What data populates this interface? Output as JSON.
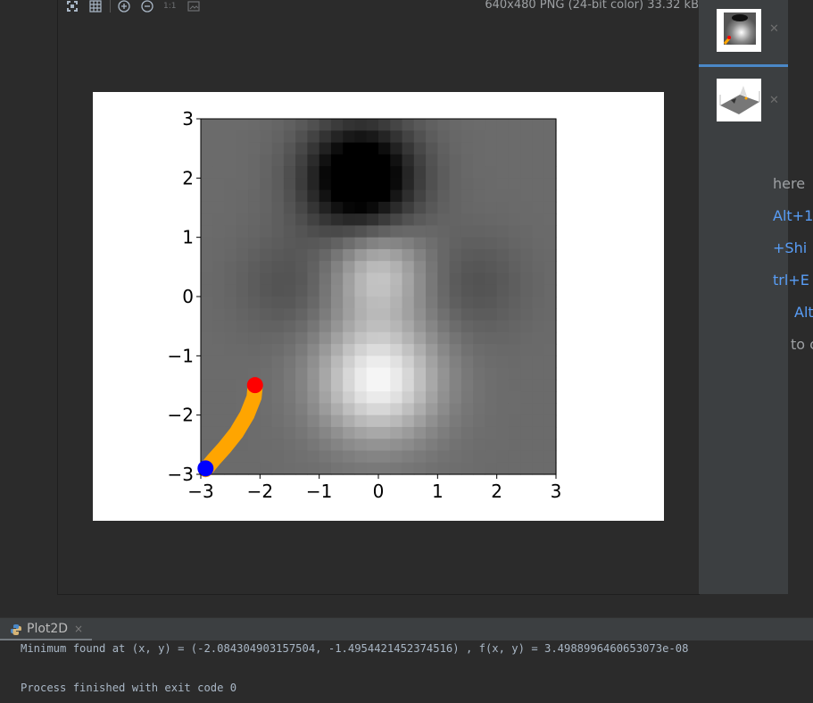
{
  "viewer": {
    "toolbar": {
      "icons": [
        "fit-window-icon",
        "grid-icon",
        "zoom-in-icon",
        "zoom-out-icon",
        "actual-size-icon",
        "background-icon"
      ],
      "actual_size_label": "1:1"
    },
    "image_info": "640x480 PNG (24-bit color) 33.32 kB"
  },
  "chart_data": {
    "type": "heatmap",
    "title": "",
    "xlabel": "",
    "ylabel": "",
    "xlim": [
      -3,
      3
    ],
    "ylim": [
      -3,
      3
    ],
    "xticks": [
      "−3",
      "−2",
      "−1",
      "0",
      "1",
      "2",
      "3"
    ],
    "yticks": [
      "−3",
      "−2",
      "−1",
      "0",
      "1",
      "2",
      "3"
    ],
    "colormap": "gray",
    "grid": false,
    "heatmap_features": {
      "darkest_at": [
        -0.4,
        2.0
      ],
      "brightest_at": [
        0.0,
        -1.4
      ]
    },
    "series": [
      {
        "type": "line",
        "color": "#ffa500",
        "x": [
          -2.92,
          -2.78,
          -2.6,
          -2.4,
          -2.22,
          -2.1,
          -2.08
        ],
        "y": [
          -2.92,
          -2.75,
          -2.55,
          -2.3,
          -2.0,
          -1.7,
          -1.5
        ]
      }
    ],
    "markers": [
      {
        "color": "#ff0000",
        "x": -2.084,
        "y": -1.495
      },
      {
        "color": "#0000ff",
        "x": -2.92,
        "y": -2.9
      }
    ]
  },
  "thumbnails": [
    {
      "name": "heatmap-plot",
      "selected": true
    },
    {
      "name": "surface-plot",
      "selected": false
    }
  ],
  "tips": [
    {
      "text": "here",
      "color": "#9da0a3"
    },
    {
      "text": "Alt+1",
      "color": "#589df6"
    },
    {
      "text": "+Shi",
      "color": "#589df6"
    },
    {
      "text": "trl+E",
      "color": "#589df6"
    },
    {
      "text": "Alt",
      "color": "#589df6"
    },
    {
      "text": "to c",
      "color": "#9da0a3"
    }
  ],
  "bottom_tab": {
    "label": "Plot2D",
    "close": "×"
  },
  "console": {
    "lines": [
      "Minimum found at (x, y) = (-2.084304903157504, -1.4954421452374516) , f(x, y) = 3.4988996460653073e-08",
      "",
      "Process finished with exit code 0"
    ]
  }
}
